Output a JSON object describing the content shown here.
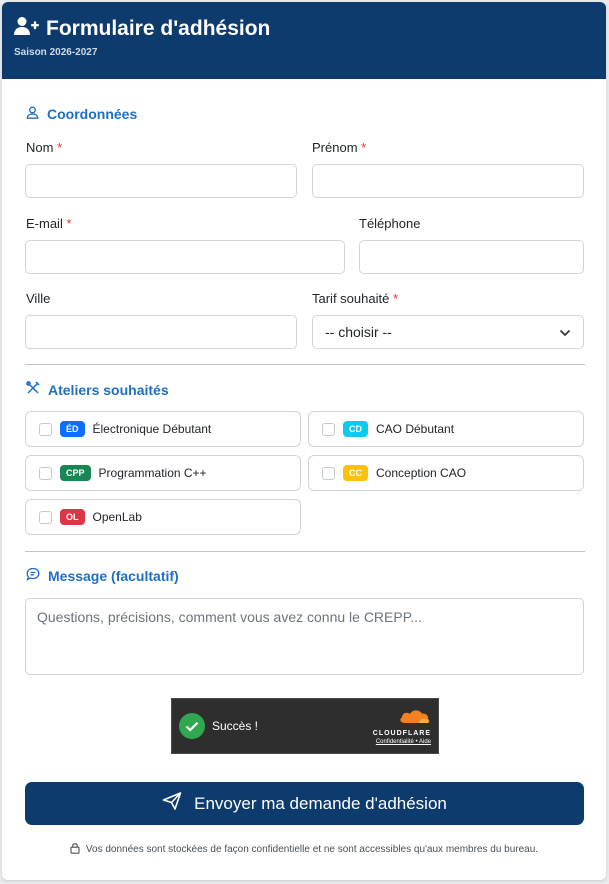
{
  "header": {
    "title": "Formulaire d'adhésion",
    "subtitle": "Saison 2026-2027",
    "icon": "user-plus-icon"
  },
  "contact": {
    "section_title": "Coordonnées",
    "icon": "person-icon",
    "fields": {
      "nom": {
        "label": "Nom",
        "required": "*",
        "value": ""
      },
      "prenom": {
        "label": "Prénom",
        "required": "*",
        "value": ""
      },
      "email": {
        "label": "E-mail",
        "required": "*",
        "value": ""
      },
      "telephone": {
        "label": "Téléphone",
        "value": ""
      },
      "ville": {
        "label": "Ville",
        "value": ""
      },
      "tarif": {
        "label": "Tarif souhaité",
        "required": "*",
        "selected": "-- choisir --"
      }
    }
  },
  "workshops": {
    "section_title": "Ateliers souhaités",
    "icon": "tools-icon",
    "items": [
      {
        "code": "ÉD",
        "label": "Électronique Débutant",
        "color": "#0d6efd",
        "checked": false
      },
      {
        "code": "CD",
        "label": "CAO Débutant",
        "color": "#0dcaf0",
        "checked": false
      },
      {
        "code": "CPP",
        "label": "Programmation C++",
        "color": "#198754",
        "checked": false
      },
      {
        "code": "CC",
        "label": "Conception CAO",
        "color": "#ffc107",
        "checked": false
      },
      {
        "code": "OL",
        "label": "OpenLab",
        "color": "#dc3545",
        "checked": false
      }
    ]
  },
  "message": {
    "section_title": "Message (facultatif)",
    "icon": "chat-icon",
    "placeholder": "Questions, précisions, comment vous avez connu le CREPP..."
  },
  "captcha": {
    "status": "Succès !",
    "brand": "CLOUDFLARE",
    "privacy_link": "Confidentialité",
    "separator": "•",
    "help_link": "Aide"
  },
  "submit": {
    "label": "Envoyer ma demande d'adhésion",
    "icon": "send-icon"
  },
  "footer": {
    "note": "Vos données sont stockées de façon confidentielle et ne sont accessibles qu'aux membres du bureau.",
    "icon": "lock-icon"
  },
  "colors": {
    "header_bg": "#0d3b6e",
    "accent": "#1f6fc5",
    "required": "#dc3545",
    "captcha_success": "#2fa84f"
  }
}
